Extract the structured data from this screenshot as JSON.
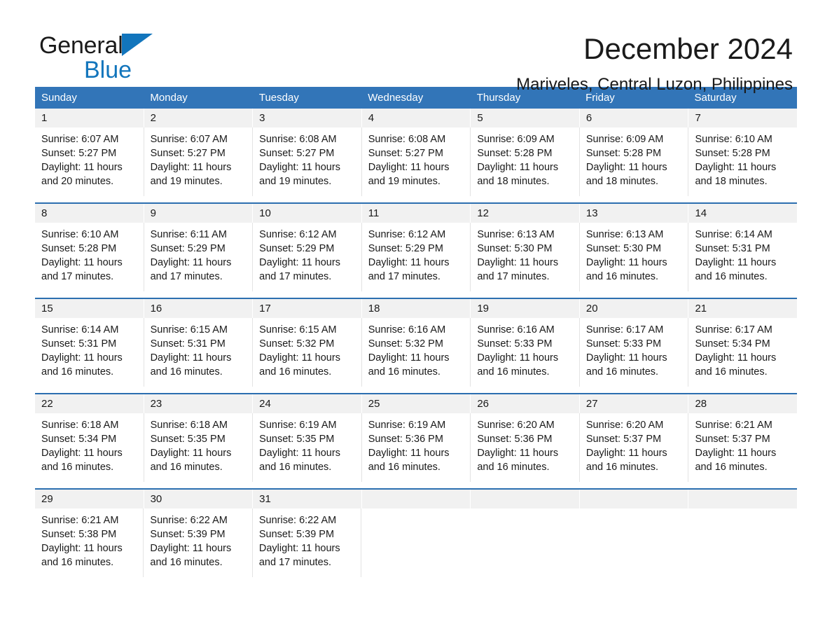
{
  "brand": {
    "name_part1": "General",
    "name_part2": "Blue",
    "triangle_color": "#1275bc"
  },
  "header": {
    "title": "December 2024",
    "subtitle": "Mariveles, Central Luzon, Philippines"
  },
  "theme": {
    "header_blue": "#3275b8",
    "row_rule_blue": "#2c6fb0",
    "date_band_gray": "#f1f1f1"
  },
  "weekdays": [
    "Sunday",
    "Monday",
    "Tuesday",
    "Wednesday",
    "Thursday",
    "Friday",
    "Saturday"
  ],
  "weeks": [
    {
      "days": [
        {
          "date": "1",
          "sunrise": "Sunrise: 6:07 AM",
          "sunset": "Sunset: 5:27 PM",
          "daylight_1": "Daylight: 11 hours",
          "daylight_2": "and 20 minutes."
        },
        {
          "date": "2",
          "sunrise": "Sunrise: 6:07 AM",
          "sunset": "Sunset: 5:27 PM",
          "daylight_1": "Daylight: 11 hours",
          "daylight_2": "and 19 minutes."
        },
        {
          "date": "3",
          "sunrise": "Sunrise: 6:08 AM",
          "sunset": "Sunset: 5:27 PM",
          "daylight_1": "Daylight: 11 hours",
          "daylight_2": "and 19 minutes."
        },
        {
          "date": "4",
          "sunrise": "Sunrise: 6:08 AM",
          "sunset": "Sunset: 5:27 PM",
          "daylight_1": "Daylight: 11 hours",
          "daylight_2": "and 19 minutes."
        },
        {
          "date": "5",
          "sunrise": "Sunrise: 6:09 AM",
          "sunset": "Sunset: 5:28 PM",
          "daylight_1": "Daylight: 11 hours",
          "daylight_2": "and 18 minutes."
        },
        {
          "date": "6",
          "sunrise": "Sunrise: 6:09 AM",
          "sunset": "Sunset: 5:28 PM",
          "daylight_1": "Daylight: 11 hours",
          "daylight_2": "and 18 minutes."
        },
        {
          "date": "7",
          "sunrise": "Sunrise: 6:10 AM",
          "sunset": "Sunset: 5:28 PM",
          "daylight_1": "Daylight: 11 hours",
          "daylight_2": "and 18 minutes."
        }
      ]
    },
    {
      "days": [
        {
          "date": "8",
          "sunrise": "Sunrise: 6:10 AM",
          "sunset": "Sunset: 5:28 PM",
          "daylight_1": "Daylight: 11 hours",
          "daylight_2": "and 17 minutes."
        },
        {
          "date": "9",
          "sunrise": "Sunrise: 6:11 AM",
          "sunset": "Sunset: 5:29 PM",
          "daylight_1": "Daylight: 11 hours",
          "daylight_2": "and 17 minutes."
        },
        {
          "date": "10",
          "sunrise": "Sunrise: 6:12 AM",
          "sunset": "Sunset: 5:29 PM",
          "daylight_1": "Daylight: 11 hours",
          "daylight_2": "and 17 minutes."
        },
        {
          "date": "11",
          "sunrise": "Sunrise: 6:12 AM",
          "sunset": "Sunset: 5:29 PM",
          "daylight_1": "Daylight: 11 hours",
          "daylight_2": "and 17 minutes."
        },
        {
          "date": "12",
          "sunrise": "Sunrise: 6:13 AM",
          "sunset": "Sunset: 5:30 PM",
          "daylight_1": "Daylight: 11 hours",
          "daylight_2": "and 17 minutes."
        },
        {
          "date": "13",
          "sunrise": "Sunrise: 6:13 AM",
          "sunset": "Sunset: 5:30 PM",
          "daylight_1": "Daylight: 11 hours",
          "daylight_2": "and 16 minutes."
        },
        {
          "date": "14",
          "sunrise": "Sunrise: 6:14 AM",
          "sunset": "Sunset: 5:31 PM",
          "daylight_1": "Daylight: 11 hours",
          "daylight_2": "and 16 minutes."
        }
      ]
    },
    {
      "days": [
        {
          "date": "15",
          "sunrise": "Sunrise: 6:14 AM",
          "sunset": "Sunset: 5:31 PM",
          "daylight_1": "Daylight: 11 hours",
          "daylight_2": "and 16 minutes."
        },
        {
          "date": "16",
          "sunrise": "Sunrise: 6:15 AM",
          "sunset": "Sunset: 5:31 PM",
          "daylight_1": "Daylight: 11 hours",
          "daylight_2": "and 16 minutes."
        },
        {
          "date": "17",
          "sunrise": "Sunrise: 6:15 AM",
          "sunset": "Sunset: 5:32 PM",
          "daylight_1": "Daylight: 11 hours",
          "daylight_2": "and 16 minutes."
        },
        {
          "date": "18",
          "sunrise": "Sunrise: 6:16 AM",
          "sunset": "Sunset: 5:32 PM",
          "daylight_1": "Daylight: 11 hours",
          "daylight_2": "and 16 minutes."
        },
        {
          "date": "19",
          "sunrise": "Sunrise: 6:16 AM",
          "sunset": "Sunset: 5:33 PM",
          "daylight_1": "Daylight: 11 hours",
          "daylight_2": "and 16 minutes."
        },
        {
          "date": "20",
          "sunrise": "Sunrise: 6:17 AM",
          "sunset": "Sunset: 5:33 PM",
          "daylight_1": "Daylight: 11 hours",
          "daylight_2": "and 16 minutes."
        },
        {
          "date": "21",
          "sunrise": "Sunrise: 6:17 AM",
          "sunset": "Sunset: 5:34 PM",
          "daylight_1": "Daylight: 11 hours",
          "daylight_2": "and 16 minutes."
        }
      ]
    },
    {
      "days": [
        {
          "date": "22",
          "sunrise": "Sunrise: 6:18 AM",
          "sunset": "Sunset: 5:34 PM",
          "daylight_1": "Daylight: 11 hours",
          "daylight_2": "and 16 minutes."
        },
        {
          "date": "23",
          "sunrise": "Sunrise: 6:18 AM",
          "sunset": "Sunset: 5:35 PM",
          "daylight_1": "Daylight: 11 hours",
          "daylight_2": "and 16 minutes."
        },
        {
          "date": "24",
          "sunrise": "Sunrise: 6:19 AM",
          "sunset": "Sunset: 5:35 PM",
          "daylight_1": "Daylight: 11 hours",
          "daylight_2": "and 16 minutes."
        },
        {
          "date": "25",
          "sunrise": "Sunrise: 6:19 AM",
          "sunset": "Sunset: 5:36 PM",
          "daylight_1": "Daylight: 11 hours",
          "daylight_2": "and 16 minutes."
        },
        {
          "date": "26",
          "sunrise": "Sunrise: 6:20 AM",
          "sunset": "Sunset: 5:36 PM",
          "daylight_1": "Daylight: 11 hours",
          "daylight_2": "and 16 minutes."
        },
        {
          "date": "27",
          "sunrise": "Sunrise: 6:20 AM",
          "sunset": "Sunset: 5:37 PM",
          "daylight_1": "Daylight: 11 hours",
          "daylight_2": "and 16 minutes."
        },
        {
          "date": "28",
          "sunrise": "Sunrise: 6:21 AM",
          "sunset": "Sunset: 5:37 PM",
          "daylight_1": "Daylight: 11 hours",
          "daylight_2": "and 16 minutes."
        }
      ]
    },
    {
      "days": [
        {
          "date": "29",
          "sunrise": "Sunrise: 6:21 AM",
          "sunset": "Sunset: 5:38 PM",
          "daylight_1": "Daylight: 11 hours",
          "daylight_2": "and 16 minutes."
        },
        {
          "date": "30",
          "sunrise": "Sunrise: 6:22 AM",
          "sunset": "Sunset: 5:39 PM",
          "daylight_1": "Daylight: 11 hours",
          "daylight_2": "and 16 minutes."
        },
        {
          "date": "31",
          "sunrise": "Sunrise: 6:22 AM",
          "sunset": "Sunset: 5:39 PM",
          "daylight_1": "Daylight: 11 hours",
          "daylight_2": "and 17 minutes."
        },
        {
          "date": "",
          "sunrise": "",
          "sunset": "",
          "daylight_1": "",
          "daylight_2": ""
        },
        {
          "date": "",
          "sunrise": "",
          "sunset": "",
          "daylight_1": "",
          "daylight_2": ""
        },
        {
          "date": "",
          "sunrise": "",
          "sunset": "",
          "daylight_1": "",
          "daylight_2": ""
        },
        {
          "date": "",
          "sunrise": "",
          "sunset": "",
          "daylight_1": "",
          "daylight_2": ""
        }
      ]
    }
  ]
}
